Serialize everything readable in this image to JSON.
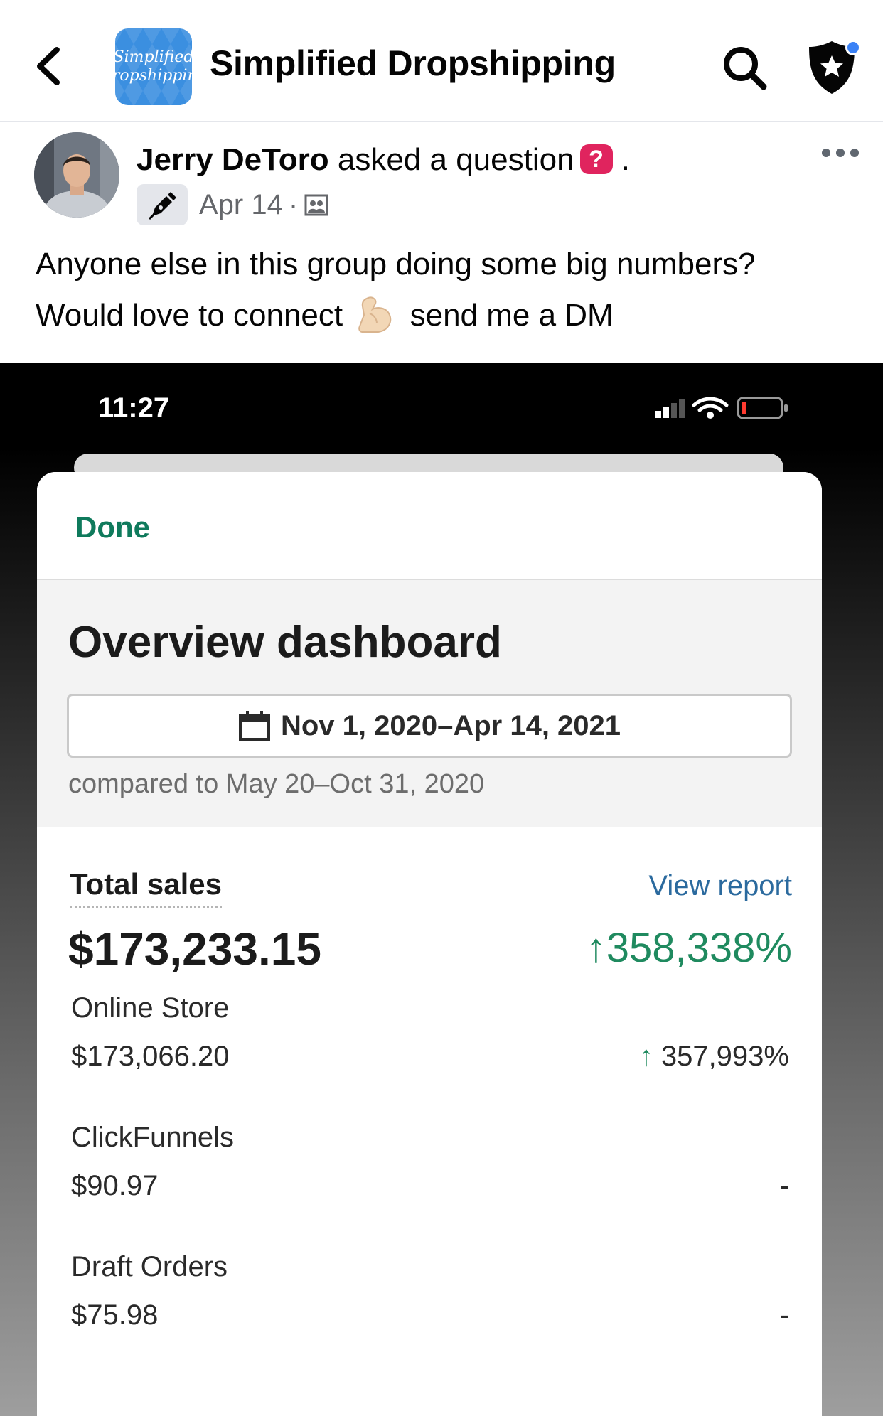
{
  "group": {
    "name": "Simplified Dropshipping",
    "avatar_line1": "Simplified",
    "avatar_line2": "Dropshipping"
  },
  "post": {
    "author": "Jerry DeToro",
    "action": "asked a question",
    "question_badge": "?",
    "trailing_period": ".",
    "date": "Apr 14",
    "meta_separator": "·",
    "text_line1": "Anyone else in this group doing some big numbers?",
    "text_line2_before": "Would love to connect",
    "text_line2_after": "send me a DM"
  },
  "screenshot": {
    "status_time": "11:27",
    "done_label": "Done",
    "title": "Overview dashboard",
    "date_range": "Nov 1, 2020–Apr 14, 2021",
    "compared_to": "compared to May 20–Oct 31, 2020",
    "total_sales_label": "Total sales",
    "view_report_label": "View report",
    "total_sales_value": "$173,233.15",
    "total_sales_change": "↑358,338%",
    "channels": [
      {
        "name": "Online Store",
        "value": "$173,066.20",
        "change_arrow": "↑",
        "change": " 357,993%"
      },
      {
        "name": "ClickFunnels",
        "value": "$90.97",
        "change": "-"
      },
      {
        "name": "Draft Orders",
        "value": "$75.98",
        "change": "-"
      }
    ]
  },
  "colors": {
    "accent_green": "#1f8a5f",
    "link_blue": "#2b6a9e",
    "question_red": "#e0245e",
    "group_avatar_blue": "#3b8fe0"
  }
}
